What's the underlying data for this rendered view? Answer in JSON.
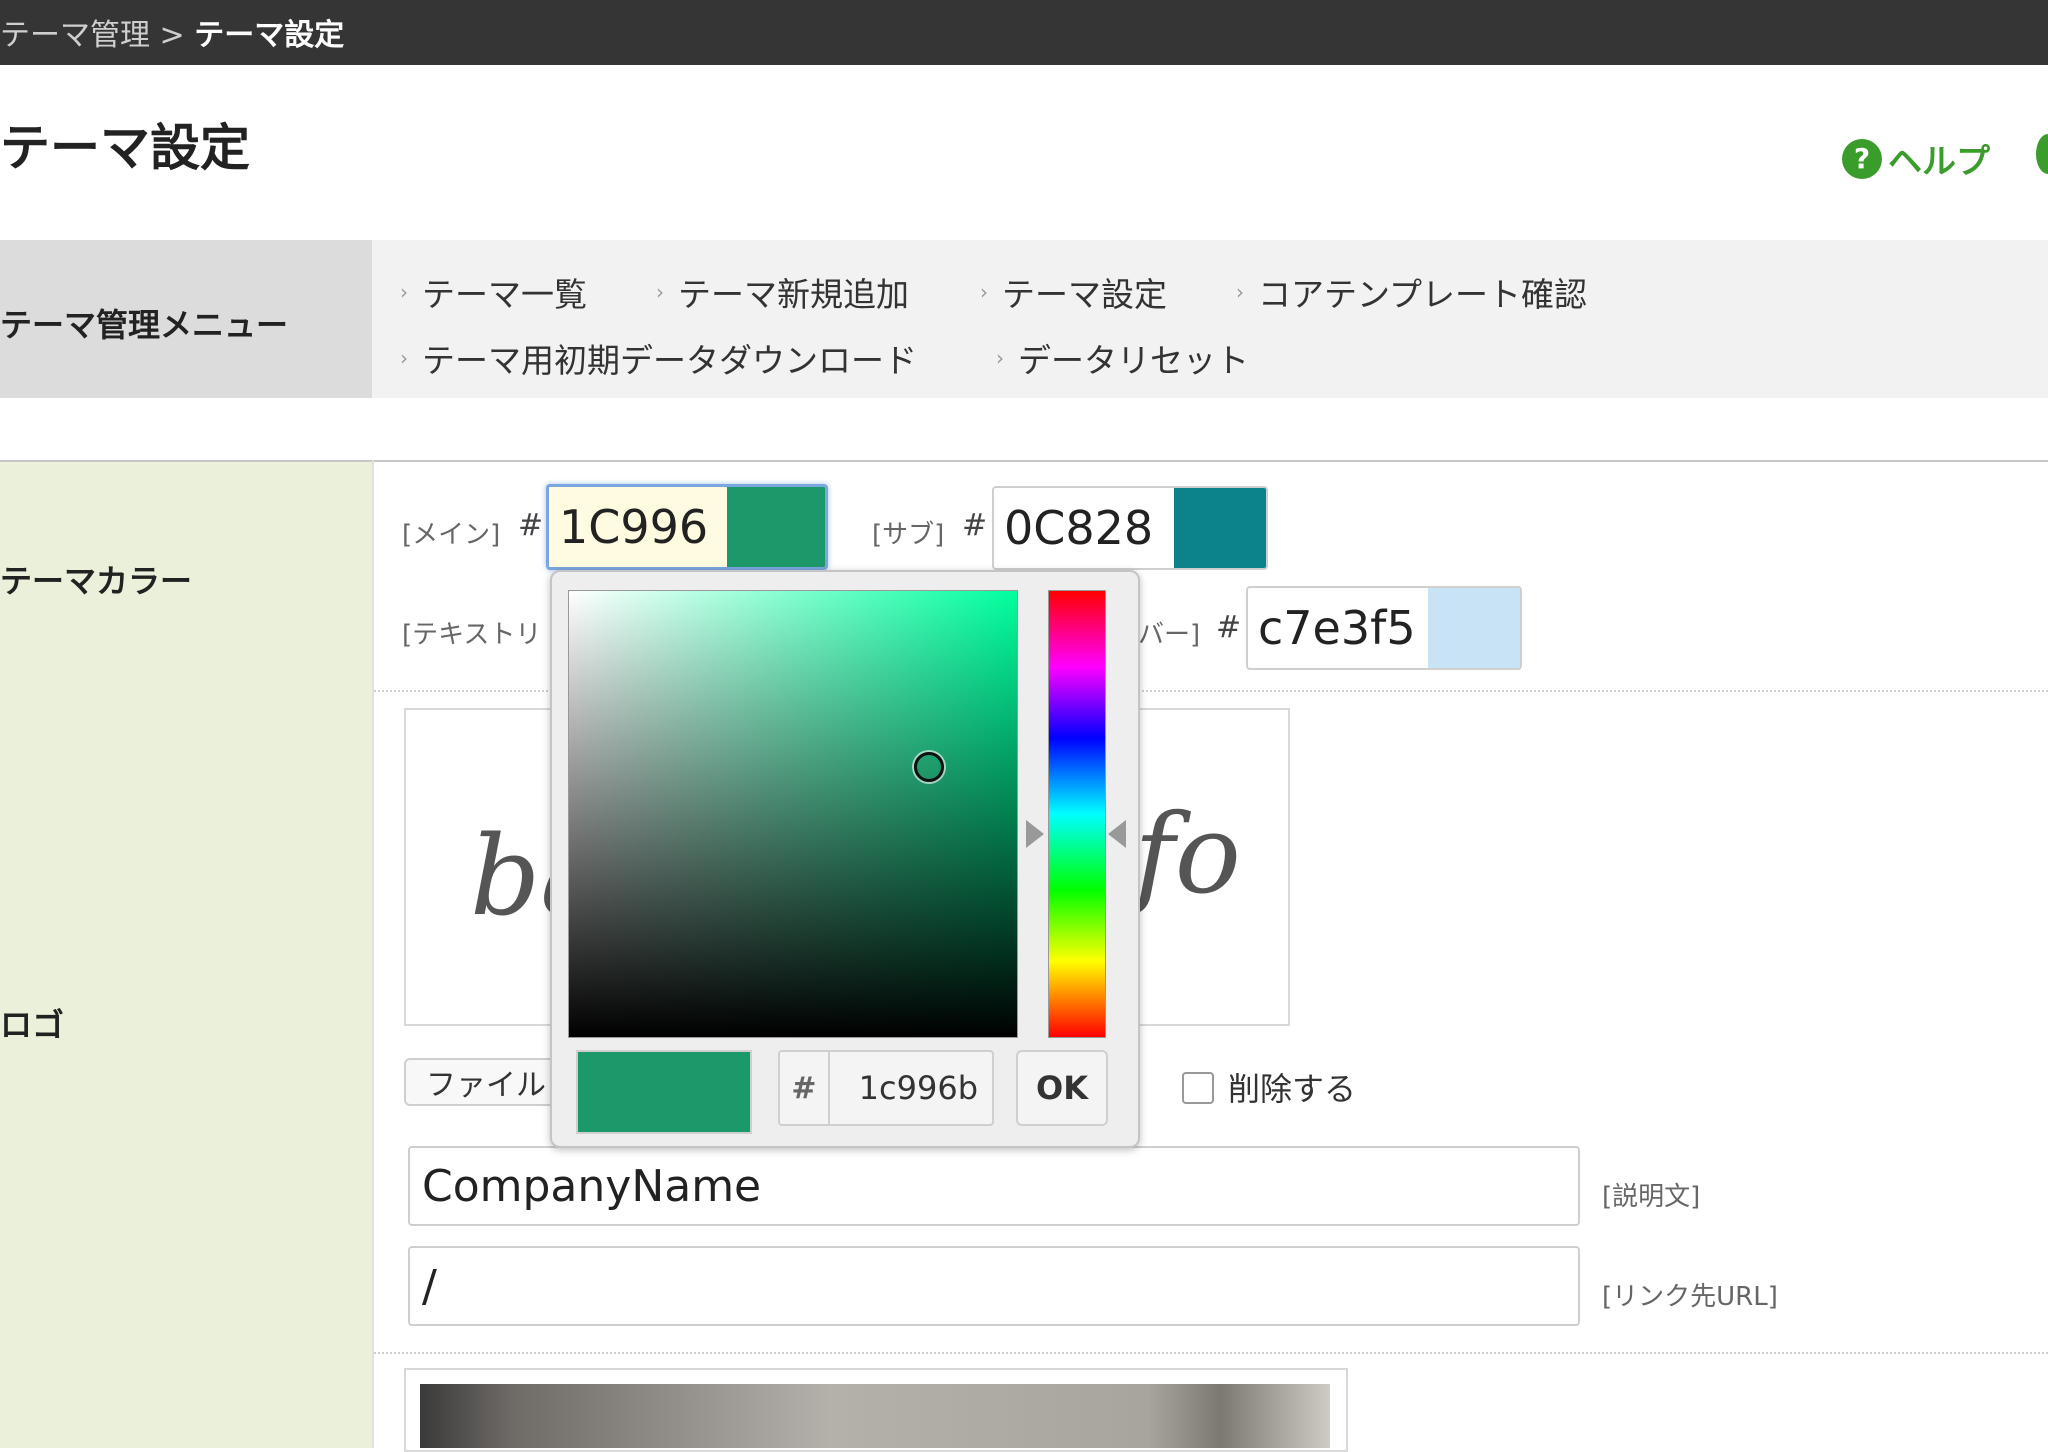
{
  "breadcrumb": {
    "parent": "テーマ管理",
    "separator": " > ",
    "current": "テーマ設定"
  },
  "page": {
    "title": "テーマ設定"
  },
  "help": {
    "label": "ヘルプ",
    "icon": "question-circle-icon",
    "icon_glyph": "?"
  },
  "menu": {
    "label": "テーマ管理メニュー",
    "arrow_glyph": "›",
    "items": [
      {
        "label": "テーマ一覧"
      },
      {
        "label": "テーマ新規追加"
      },
      {
        "label": "テーマ設定"
      },
      {
        "label": "コアテンプレート確認"
      },
      {
        "label": "テーマ用初期データダウンロード"
      },
      {
        "label": "データリセット"
      }
    ]
  },
  "theme_color": {
    "label": "テーマカラー",
    "hash": "#",
    "main": {
      "label": "[メイン]",
      "value": "1C996",
      "color": "#1c996b"
    },
    "sub": {
      "label": "[サブ]",
      "value": "0C828",
      "color": "#0c828a"
    },
    "text_label": "[テキストリ",
    "hover": {
      "label": "バー]",
      "value": "c7e3f5",
      "color": "#c7e3f5"
    }
  },
  "logo": {
    "label": "ロゴ",
    "preview_text_left": "ba",
    "preview_text_right": "fo",
    "file_button": "ファイル",
    "delete_label": "削除する",
    "company_name": "CompanyName",
    "description_label": "[説明文]",
    "link_url": "/",
    "link_url_label": "[リンク先URL]"
  },
  "color_picker": {
    "hash": "#",
    "hex": "1c996b",
    "ok_label": "OK",
    "selected_color": "#1c996b"
  }
}
